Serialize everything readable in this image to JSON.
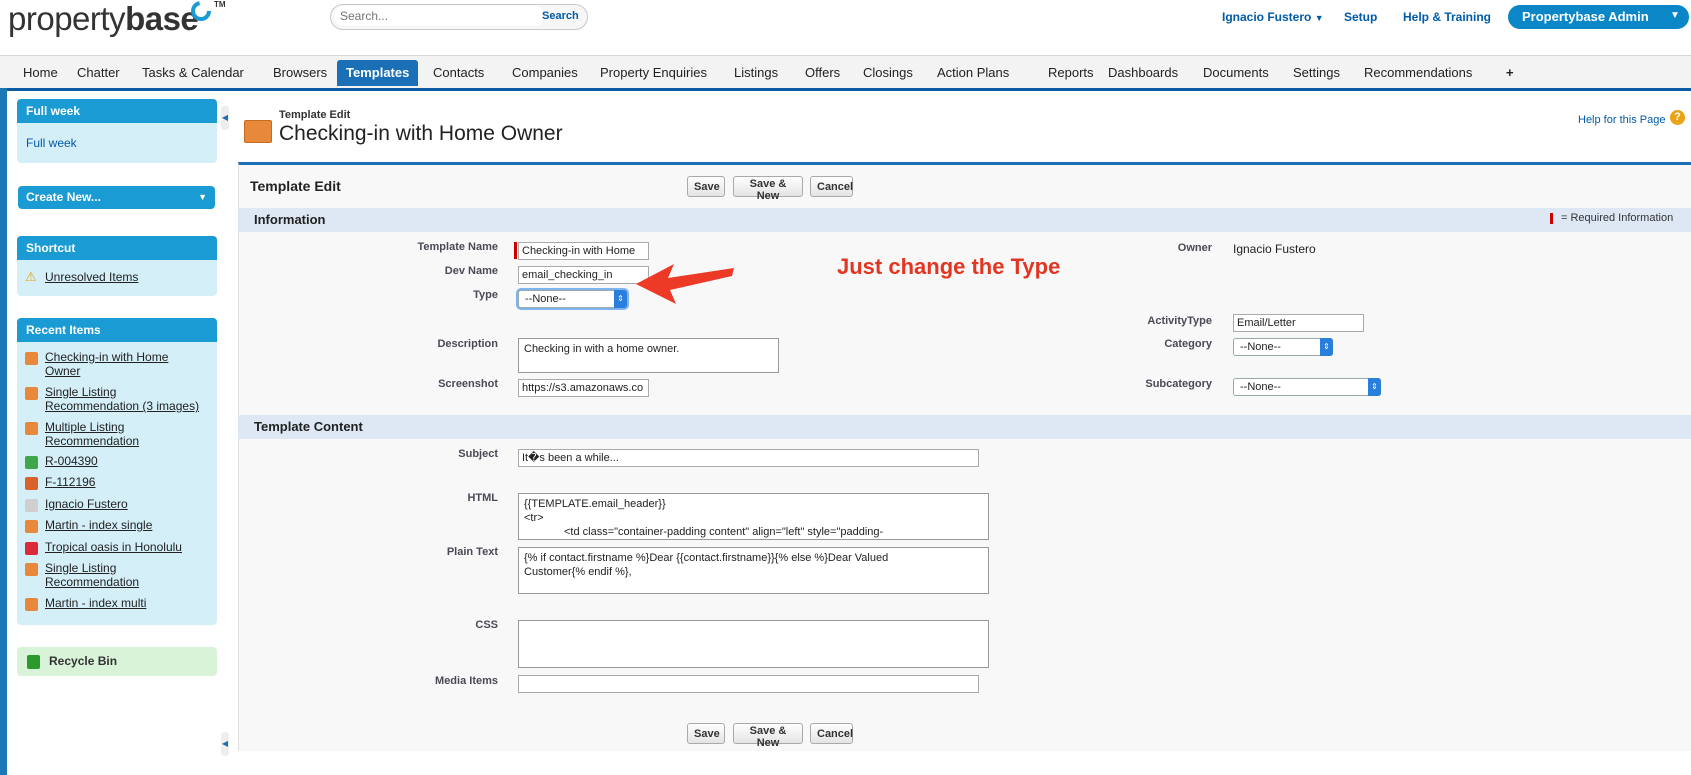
{
  "header": {
    "logo_light": "property",
    "logo_bold": "base",
    "logo_tm": "TM",
    "search_placeholder": "Search...",
    "search_button": "Search",
    "user_menu": "Ignacio Fustero",
    "setup": "Setup",
    "help_training": "Help & Training",
    "admin_button": "Propertybase Admin"
  },
  "tabs": [
    "Home",
    "Chatter",
    "Tasks & Calendar",
    "Browsers",
    "Templates",
    "Contacts",
    "Companies",
    "Property Enquiries",
    "Listings",
    "Offers",
    "Closings",
    "Action Plans",
    "Reports",
    "Dashboards",
    "Documents",
    "Settings",
    "Recommendations",
    "+"
  ],
  "active_tab": "Templates",
  "sidebar": {
    "fullweek_title": "Full week",
    "fullweek_link": "Full week",
    "create_new": "Create New...",
    "shortcut_title": "Shortcut",
    "shortcut_item": "Unresolved Items",
    "recent_title": "Recent Items",
    "recent_items": [
      {
        "line1": "Checking-in with Home",
        "line2": "Owner",
        "icon": "template-icon"
      },
      {
        "line1": "Single Listing",
        "line2": "Recommendation (3 images)",
        "icon": "template-icon"
      },
      {
        "line1": "Multiple Listing",
        "line2": "Recommendation",
        "icon": "template-icon"
      },
      {
        "line1": "R-004390",
        "line2": "",
        "icon": "recommendation-icon"
      },
      {
        "line1": "F-112196",
        "line2": "",
        "icon": "star-icon"
      },
      {
        "line1": "Ignacio Fustero",
        "line2": "",
        "icon": "contact-icon"
      },
      {
        "line1": "Martin - index single",
        "line2": "",
        "icon": "template-icon"
      },
      {
        "line1": "Tropical oasis in Honolulu",
        "line2": "",
        "icon": "listing-icon"
      },
      {
        "line1": "Single Listing",
        "line2": "Recommendation",
        "icon": "template-icon"
      },
      {
        "line1": "Martin - index multi",
        "line2": "",
        "icon": "template-icon"
      }
    ],
    "recycle_bin": "Recycle Bin"
  },
  "page": {
    "subtitle": "Template Edit",
    "title": "Checking-in with Home Owner",
    "help_link": "Help for this Page",
    "panel_title": "Template Edit",
    "save": "Save",
    "save_new": "Save & New",
    "cancel": "Cancel",
    "required_info": "= Required Information"
  },
  "information": {
    "section_title": "Information",
    "template_name_label": "Template Name",
    "template_name_value": "Checking-in with Home",
    "dev_name_label": "Dev Name",
    "dev_name_value": "email_checking_in",
    "type_label": "Type",
    "type_value": "--None--",
    "description_label": "Description",
    "description_value": "Checking in with a home owner.",
    "screenshot_label": "Screenshot",
    "screenshot_value": "https://s3.amazonaws.co",
    "owner_label": "Owner",
    "owner_value": "Ignacio Fustero",
    "activity_type_label": "ActivityType",
    "activity_type_value": "Email/Letter",
    "category_label": "Category",
    "category_value": "--None--",
    "subcategory_label": "Subcategory",
    "subcategory_value": "--None--"
  },
  "content": {
    "section_title": "Template Content",
    "subject_label": "Subject",
    "subject_value": "It�s been a while...",
    "html_label": "HTML",
    "html_line1": "{{TEMPLATE.email_header}}",
    "html_line2": "<tr>",
    "html_line3": "<td class=\"container-padding content\" align=\"left\" style=\"padding-",
    "plain_label": "Plain Text",
    "plain_line1": "{% if contact.firstname %}Dear {{contact.firstname}}{% else %}Dear Valued",
    "plain_line2": "Customer{% endif %},",
    "css_label": "CSS",
    "media_label": "Media Items"
  },
  "annotation": "Just change the Type",
  "colors": {
    "accent": "#1a6fb7",
    "required": "#cc0000",
    "annotation": "#e33622"
  }
}
